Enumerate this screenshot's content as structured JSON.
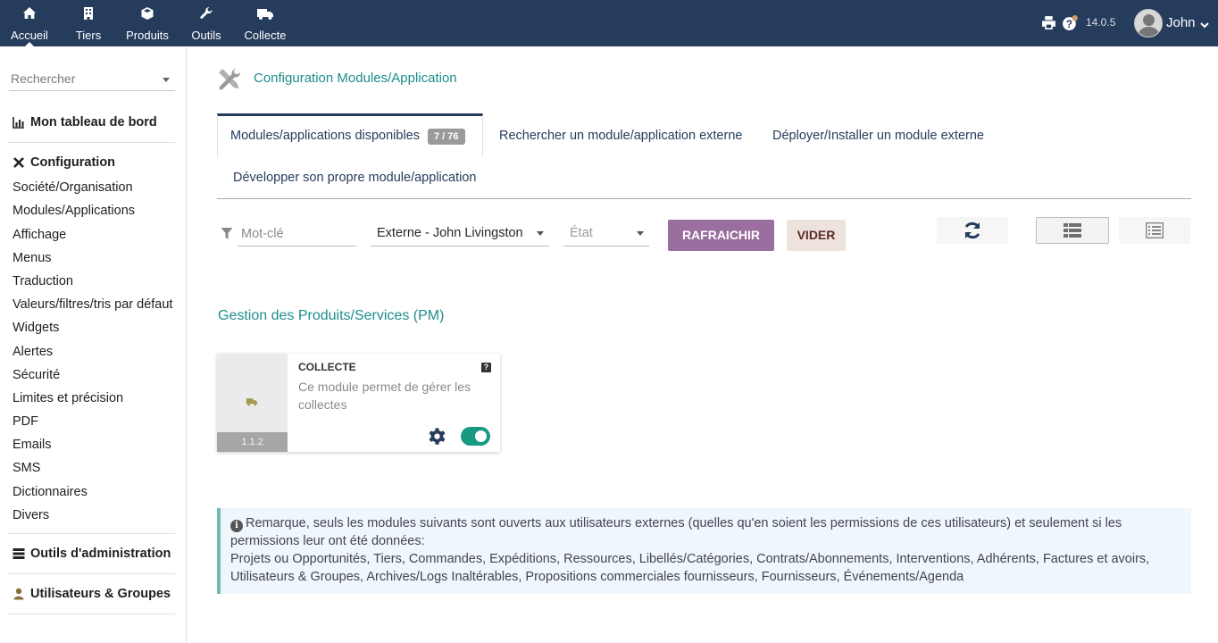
{
  "topnav": {
    "items": [
      {
        "label": "Accueil",
        "icon": "home-icon"
      },
      {
        "label": "Tiers",
        "icon": "building-icon"
      },
      {
        "label": "Produits",
        "icon": "cube-icon"
      },
      {
        "label": "Outils",
        "icon": "wrench-icon"
      },
      {
        "label": "Collecte",
        "icon": "truck-icon"
      }
    ],
    "version": "14.0.5",
    "user": "John"
  },
  "sidebar": {
    "search_placeholder": "Rechercher",
    "dashboard": "Mon tableau de bord",
    "config_title": "Configuration",
    "config_items": [
      "Société/Organisation",
      "Modules/Applications",
      "Affichage",
      "Menus",
      "Traduction",
      "Valeurs/filtres/tris par défaut",
      "Widgets",
      "Alertes",
      "Sécurité",
      "Limites et précision",
      "PDF",
      "Emails",
      "SMS",
      "Dictionnaires",
      "Divers"
    ],
    "admin_tools": "Outils d'administration",
    "users_groups": "Utilisateurs & Groupes"
  },
  "page": {
    "title": "Configuration Modules/Application",
    "tabs": [
      {
        "label": "Modules/applications disponibles",
        "badge": "7 / 76"
      },
      {
        "label": "Rechercher un module/application externe"
      },
      {
        "label": "Déployer/Installer un module externe"
      },
      {
        "label": "Développer son propre module/application"
      }
    ]
  },
  "filters": {
    "keyword_placeholder": "Mot-clé",
    "origin_value": "Externe - John Livingston",
    "state_placeholder": "État",
    "refresh_label": "RAFRAICHIR",
    "clear_label": "VIDER"
  },
  "section": {
    "title": "Gestion des Produits/Services (PM)"
  },
  "module": {
    "name": "COLLECTE",
    "description": "Ce module permet de gérer les collectes",
    "version": "1.1.2",
    "enabled": true
  },
  "note": {
    "line1": "Remarque, seuls les modules suivants sont ouverts aux utilisateurs externes (quelles qu'en soient les permissions de ces utilisateurs) et seulement si les permissions leur ont été données:",
    "line2": "Projets ou Opportunités, Tiers, Commandes, Expéditions, Ressources, Libellés/Catégories, Contrats/Abonnements, Interventions, Adhérents, Factures et avoirs, Utilisateurs & Groupes, Archives/Logs Inaltérables, Propositions commerciales fournisseurs, Fournisseurs, Événements/Agenda"
  },
  "colors": {
    "topbar": "#263c5c",
    "accent_teal": "#1d8c8c",
    "refresh_button": "#9a6e9e",
    "toggle_on": "#189a82"
  }
}
